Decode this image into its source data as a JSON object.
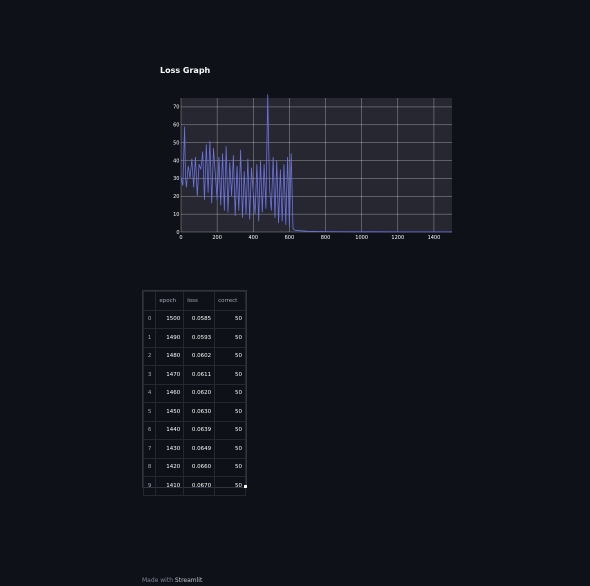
{
  "header": {
    "title": "Loss Graph"
  },
  "chart_data": {
    "type": "line",
    "title": "",
    "xlabel": "",
    "ylabel": "",
    "xlim": [
      0,
      1500
    ],
    "ylim": [
      0,
      75
    ],
    "xticks": [
      0,
      200,
      400,
      600,
      800,
      1000,
      1200,
      1400
    ],
    "yticks": [
      0,
      10,
      20,
      30,
      40,
      50,
      60,
      70
    ],
    "grid": true,
    "line_color": "#6c72e0",
    "plot_background": "#262730",
    "series": [
      {
        "x": [
          0,
          10,
          20,
          25,
          30,
          40,
          50,
          60,
          70,
          80,
          90,
          100,
          110,
          120,
          130,
          140,
          150,
          160,
          170,
          180,
          190,
          200,
          210,
          220,
          230,
          240,
          250,
          260,
          270,
          280,
          290,
          300,
          310,
          320,
          330,
          340,
          350,
          360,
          370,
          380,
          390,
          400,
          410,
          420,
          430,
          440,
          450,
          460,
          470,
          480,
          490,
          500,
          510,
          520,
          530,
          540,
          550,
          560,
          570,
          580,
          590,
          600,
          610,
          620,
          630,
          650,
          700,
          800,
          900,
          1000,
          1100,
          1200,
          1300,
          1400,
          1500
        ],
        "y": [
          31,
          26,
          59,
          30,
          25,
          37,
          30,
          41,
          25,
          42,
          20,
          38,
          35,
          45,
          18,
          49,
          22,
          51,
          16,
          47,
          32,
          18,
          42,
          15,
          44,
          12,
          48,
          11,
          39,
          20,
          43,
          9,
          37,
          12,
          46,
          8,
          34,
          10,
          41,
          7,
          36,
          22,
          10,
          38,
          6,
          40,
          11,
          38,
          13,
          77,
          25,
          12,
          42,
          8,
          40,
          5,
          35,
          6,
          38,
          4,
          42,
          3,
          44,
          2,
          1,
          0.8,
          0.4,
          0.2,
          0.15,
          0.12,
          0.1,
          0.08,
          0.07,
          0.06,
          0.05
        ]
      }
    ]
  },
  "table": {
    "columns": [
      "",
      "epoch",
      "loss",
      "correct"
    ],
    "rows": [
      [
        "0",
        "1500",
        "0.0585",
        "50"
      ],
      [
        "1",
        "1490",
        "0.0593",
        "50"
      ],
      [
        "2",
        "1480",
        "0.0602",
        "50"
      ],
      [
        "3",
        "1470",
        "0.0611",
        "50"
      ],
      [
        "4",
        "1460",
        "0.0620",
        "50"
      ],
      [
        "5",
        "1450",
        "0.0630",
        "50"
      ],
      [
        "6",
        "1440",
        "0.0639",
        "50"
      ],
      [
        "7",
        "1430",
        "0.0649",
        "50"
      ],
      [
        "8",
        "1420",
        "0.0660",
        "50"
      ],
      [
        "9",
        "1410",
        "0.0670",
        "50"
      ]
    ]
  },
  "footer": {
    "prefix": "Made with ",
    "brand": "Streamlit"
  }
}
